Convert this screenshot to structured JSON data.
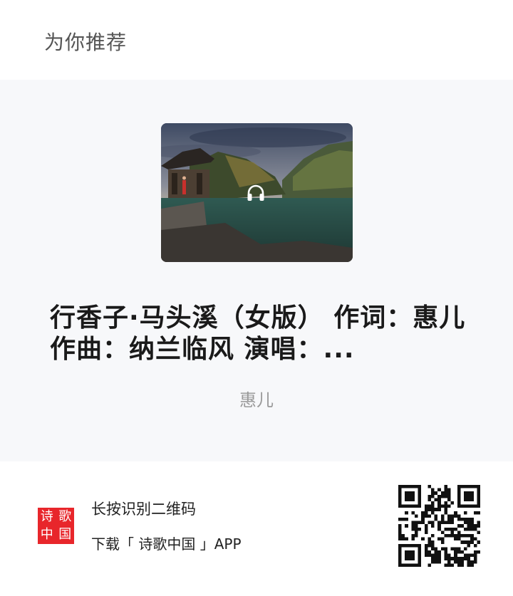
{
  "header": {
    "title": "为你推荐"
  },
  "card": {
    "cover_image": "landscape photo: pavilion by a river gorge with a person in red",
    "audio_icon": "headphones-icon",
    "title": "行香子·马头溪（女版） 作词：惠儿 作曲：纳兰临风 演唱：...",
    "artist": "惠儿"
  },
  "footer": {
    "logo_chars": [
      "诗",
      "歌",
      "中",
      "国"
    ],
    "scan_text": "长按识别二维码",
    "download_text": "下载「 诗歌中国 」APP",
    "qr_icon": "qr-code"
  },
  "colors": {
    "logo_red": "#e8262b",
    "card_bg": "#f7f8fa",
    "artist_gray": "#9a9a9a"
  }
}
